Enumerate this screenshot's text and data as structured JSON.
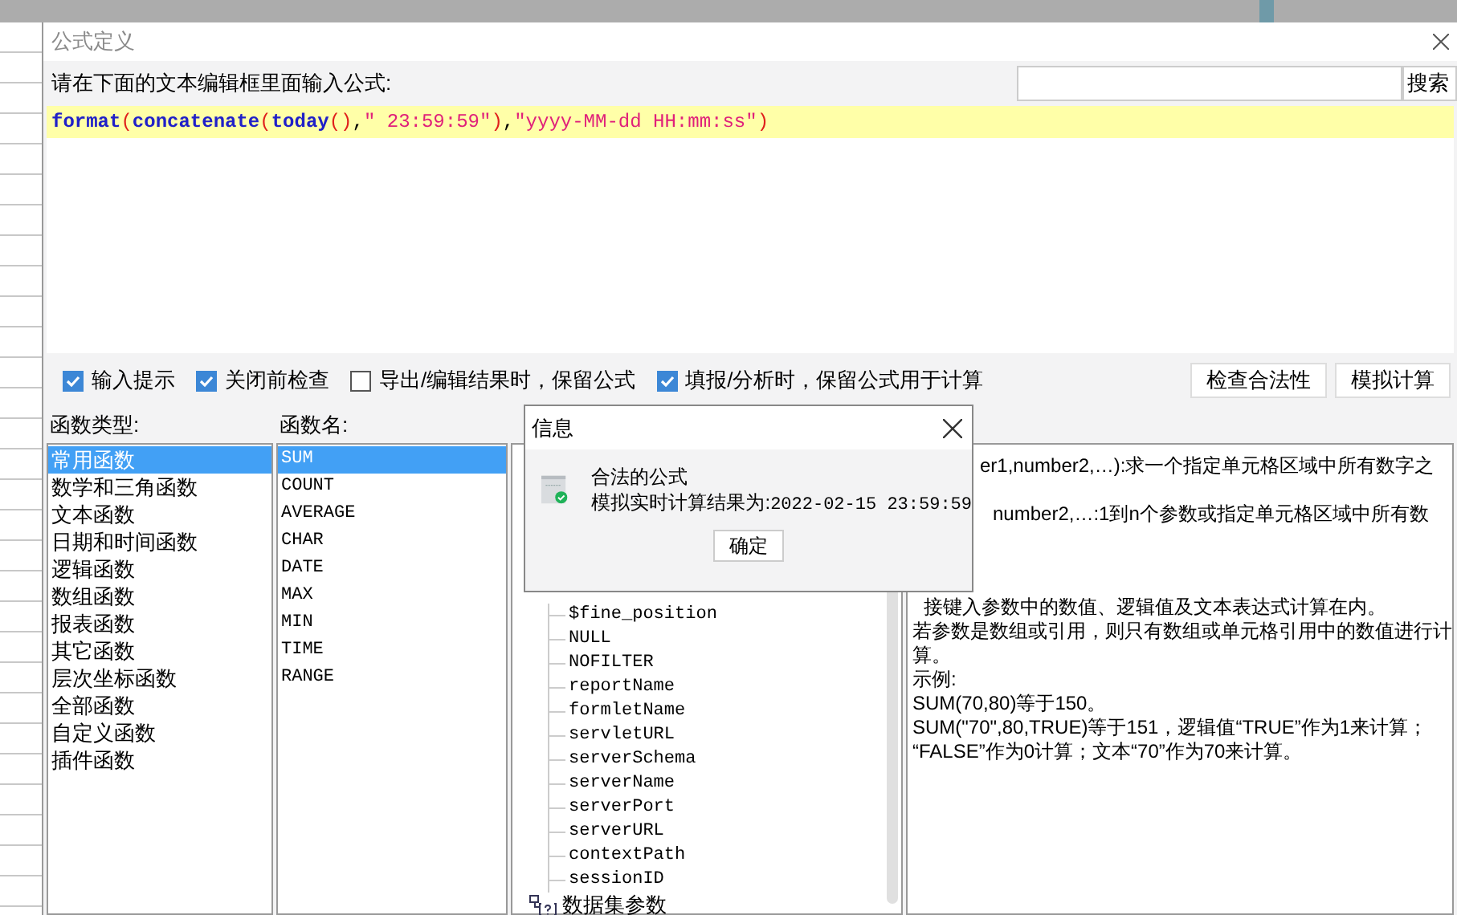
{
  "window": {
    "title": "公式定义"
  },
  "prompt": "请在下面的文本编辑框里面输入公式:",
  "search": {
    "button": "搜索"
  },
  "formula": [
    {
      "text": "format",
      "kind": "function"
    },
    {
      "text": "(",
      "kind": "paren"
    },
    {
      "text": "concatenate",
      "kind": "function"
    },
    {
      "text": "(",
      "kind": "paren"
    },
    {
      "text": "today",
      "kind": "function"
    },
    {
      "text": "()",
      "kind": "paren"
    },
    {
      "text": ",",
      "kind": "plain"
    },
    {
      "text": "\" 23:59:59\"",
      "kind": "string"
    },
    {
      "text": ")",
      "kind": "paren"
    },
    {
      "text": ",",
      "kind": "plain"
    },
    {
      "text": "\"yyyy-MM-dd HH:mm:ss\"",
      "kind": "string"
    },
    {
      "text": ")",
      "kind": "paren"
    }
  ],
  "options": [
    {
      "label": "输入提示",
      "checked": true
    },
    {
      "label": "关闭前检查",
      "checked": true
    },
    {
      "label": "导出/编辑结果时，保留公式",
      "checked": false
    },
    {
      "label": "填报/分析时，保留公式用于计算",
      "checked": true
    }
  ],
  "actions": [
    "检查合法性",
    "模拟计算"
  ],
  "function_types": {
    "title": "函数类型:",
    "items": [
      {
        "label": "常用函数",
        "selected": true
      },
      {
        "label": "数学和三角函数",
        "selected": false
      },
      {
        "label": "文本函数",
        "selected": false
      },
      {
        "label": "日期和时间函数",
        "selected": false
      },
      {
        "label": "逻辑函数",
        "selected": false
      },
      {
        "label": "数组函数",
        "selected": false
      },
      {
        "label": "报表函数",
        "selected": false
      },
      {
        "label": "其它函数",
        "selected": false
      },
      {
        "label": "层次坐标函数",
        "selected": false
      },
      {
        "label": "全部函数",
        "selected": false
      },
      {
        "label": "自定义函数",
        "selected": false
      },
      {
        "label": "插件函数",
        "selected": false
      }
    ]
  },
  "function_names": {
    "title": "函数名:",
    "items": [
      {
        "label": "SUM",
        "selected": true
      },
      {
        "label": "COUNT",
        "selected": false
      },
      {
        "label": "AVERAGE",
        "selected": false
      },
      {
        "label": "CHAR",
        "selected": false
      },
      {
        "label": "DATE",
        "selected": false
      },
      {
        "label": "MAX",
        "selected": false
      },
      {
        "label": "MIN",
        "selected": false
      },
      {
        "label": "TIME",
        "selected": false
      },
      {
        "label": "RANGE",
        "selected": false
      }
    ]
  },
  "variables": {
    "items": [
      {
        "label": "$fine_position",
        "kind": "leaf"
      },
      {
        "label": "NULL",
        "kind": "leaf"
      },
      {
        "label": "NOFILTER",
        "kind": "leaf"
      },
      {
        "label": "reportName",
        "kind": "leaf"
      },
      {
        "label": "formletName",
        "kind": "leaf"
      },
      {
        "label": "servletURL",
        "kind": "leaf"
      },
      {
        "label": "serverSchema",
        "kind": "leaf"
      },
      {
        "label": "serverName",
        "kind": "leaf"
      },
      {
        "label": "serverPort",
        "kind": "leaf"
      },
      {
        "label": "serverURL",
        "kind": "leaf"
      },
      {
        "label": "contextPath",
        "kind": "leaf"
      },
      {
        "label": "sessionID",
        "kind": "leaf"
      },
      {
        "label": "数据集参数",
        "kind": "group"
      }
    ]
  },
  "description": {
    "lines_right": [
      "er1,number2,…):求一个指定单元格区域中所有数字之",
      "number2,…:1到n个参数或指定单元格区域中所有数"
    ],
    "lines": [
      "接键入参数中的数值、逻辑值及文本表达式计算在内。",
      "若参数是数组或引用，则只有数组或单元格引用中的数值进行计",
      "算。",
      "示例:",
      "SUM(70,80)等于150。",
      "SUM(\"70\",80,TRUE)等于151，逻辑值“TRUE”作为1来计算；",
      "“FALSE”作为0计算；文本“70”作为70来计算。"
    ]
  },
  "message": {
    "title": "信息",
    "heading": "合法的公式",
    "result_label": "模拟实时计算结果为:",
    "result": "2022-02-15 23:59:59",
    "button": "确定"
  }
}
